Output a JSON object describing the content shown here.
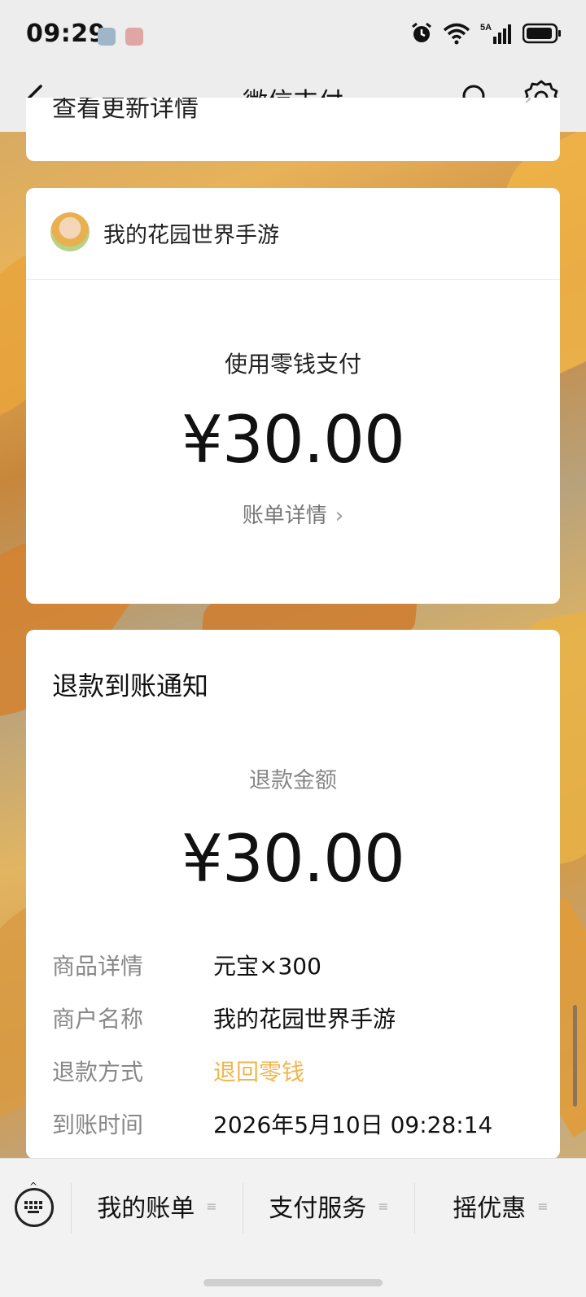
{
  "status_bar": {
    "time": "09:29"
  },
  "nav": {
    "title": "微信支付"
  },
  "partial_card": {
    "text": "查看更新详情"
  },
  "payment": {
    "merchant": "我的花园世界手游",
    "method": "使用零钱支付",
    "amount": "¥30.00",
    "bill_link": "账单详情"
  },
  "refund": {
    "title": "退款到账通知",
    "amount_label": "退款金额",
    "amount": "¥30.00",
    "details": [
      {
        "key": "商品详情",
        "value": "元宝×300"
      },
      {
        "key": "商户名称",
        "value": "我的花园世界手游"
      },
      {
        "key": "退款方式",
        "value": "退回零钱"
      },
      {
        "key": "到账时间",
        "value": "2026年5月10日 09:28:14"
      }
    ]
  },
  "bottom_tabs": [
    {
      "label": "我的账单"
    },
    {
      "label": "支付服务"
    },
    {
      "label": "摇优惠"
    }
  ],
  "colors": {
    "accent_gold": "#f0b64c"
  }
}
